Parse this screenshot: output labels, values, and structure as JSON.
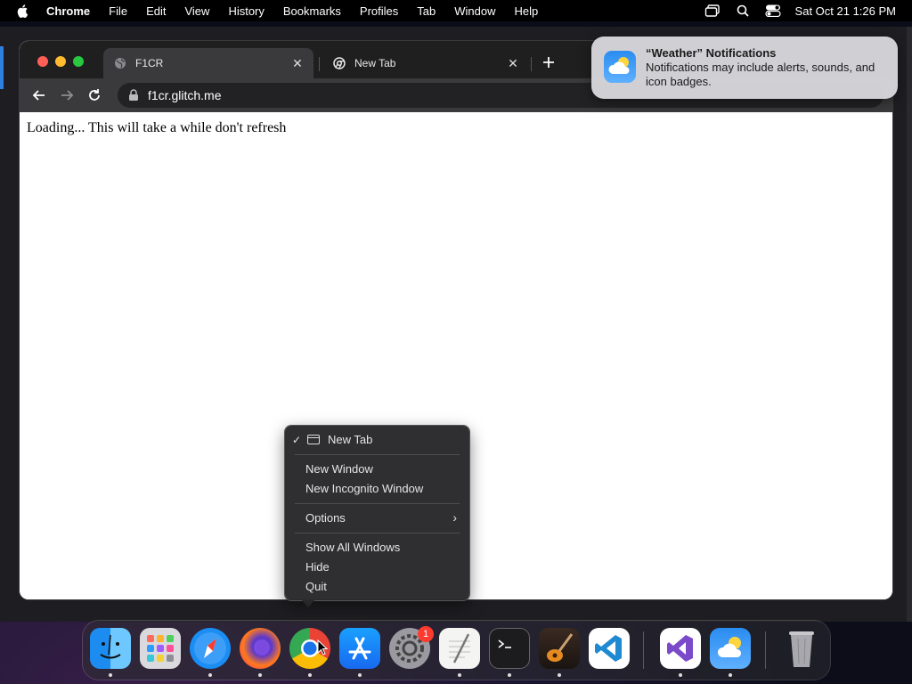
{
  "menubar": {
    "app_name": "Chrome",
    "items": [
      "File",
      "Edit",
      "View",
      "History",
      "Bookmarks",
      "Profiles",
      "Tab",
      "Window",
      "Help"
    ],
    "clock": "Sat Oct 21  1:26 PM",
    "icons": [
      "apple-icon",
      "screen-mirroring-icon",
      "spotlight-search-icon",
      "control-center-icon"
    ]
  },
  "browser": {
    "tabs": [
      {
        "label": "F1CR",
        "icon": "globe-icon"
      },
      {
        "label": "New Tab",
        "icon": "chrome-icon"
      }
    ],
    "url": "f1cr.glitch.me",
    "page_text": "Loading... This will take a while don't refresh"
  },
  "notification": {
    "title": "“Weather” Notifications",
    "body": "Notifications may include alerts, sounds, and icon badges.",
    "icon": "weather-icon"
  },
  "context_menu": {
    "current_window": "New Tab",
    "items": {
      "new_window": "New Window",
      "new_incognito": "New Incognito Window",
      "options": "Options",
      "show_all": "Show All Windows",
      "hide": "Hide",
      "quit": "Quit"
    }
  },
  "dock": {
    "apps": [
      "Finder",
      "Launchpad",
      "Safari",
      "Firefox",
      "Chrome",
      "App Store",
      "System Settings",
      "TextEdit",
      "Terminal",
      "GarageBand",
      "Visual Studio Code",
      "Visual Studio",
      "Weather",
      "Trash"
    ],
    "settings_badge": "1",
    "colors": {
      "accent": "#2f7fe0",
      "badge": "#ff3b30"
    }
  }
}
